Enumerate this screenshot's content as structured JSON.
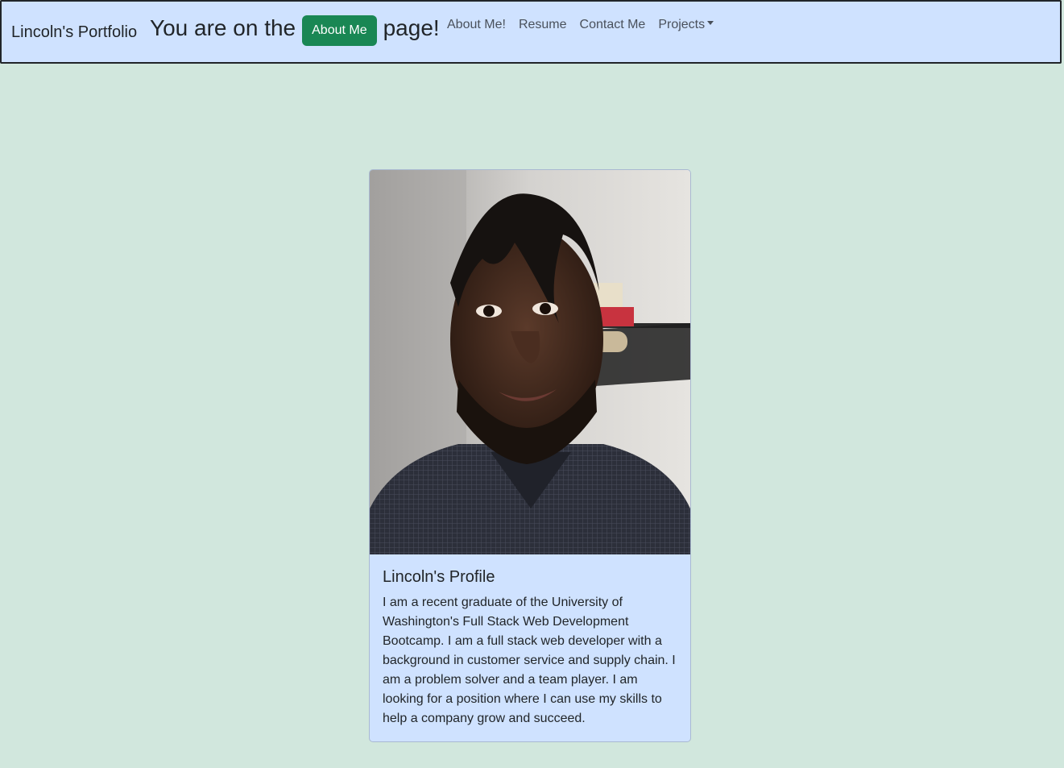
{
  "navbar": {
    "brand": "Lincoln's Portfolio",
    "headline_prefix": "You are on the",
    "current_page": "About Me",
    "headline_suffix": "page!",
    "links": [
      {
        "label": "About Me!"
      },
      {
        "label": "Resume"
      },
      {
        "label": "Contact Me"
      },
      {
        "label": "Projects"
      }
    ]
  },
  "profile": {
    "photo_icon": "profile-photo",
    "title": "Lincoln's Profile",
    "bio": "I am a recent graduate of the University of Washington's Full Stack Web Development Bootcamp. I am a full stack web developer with a background in customer service and supply chain. I am a problem solver and a team player. I am looking for a position where I can use my skills to help a company grow and succeed."
  },
  "colors": {
    "page_bg": "#d1e7dd",
    "navbar_bg": "#cfe2ff",
    "badge_green": "#198754"
  }
}
